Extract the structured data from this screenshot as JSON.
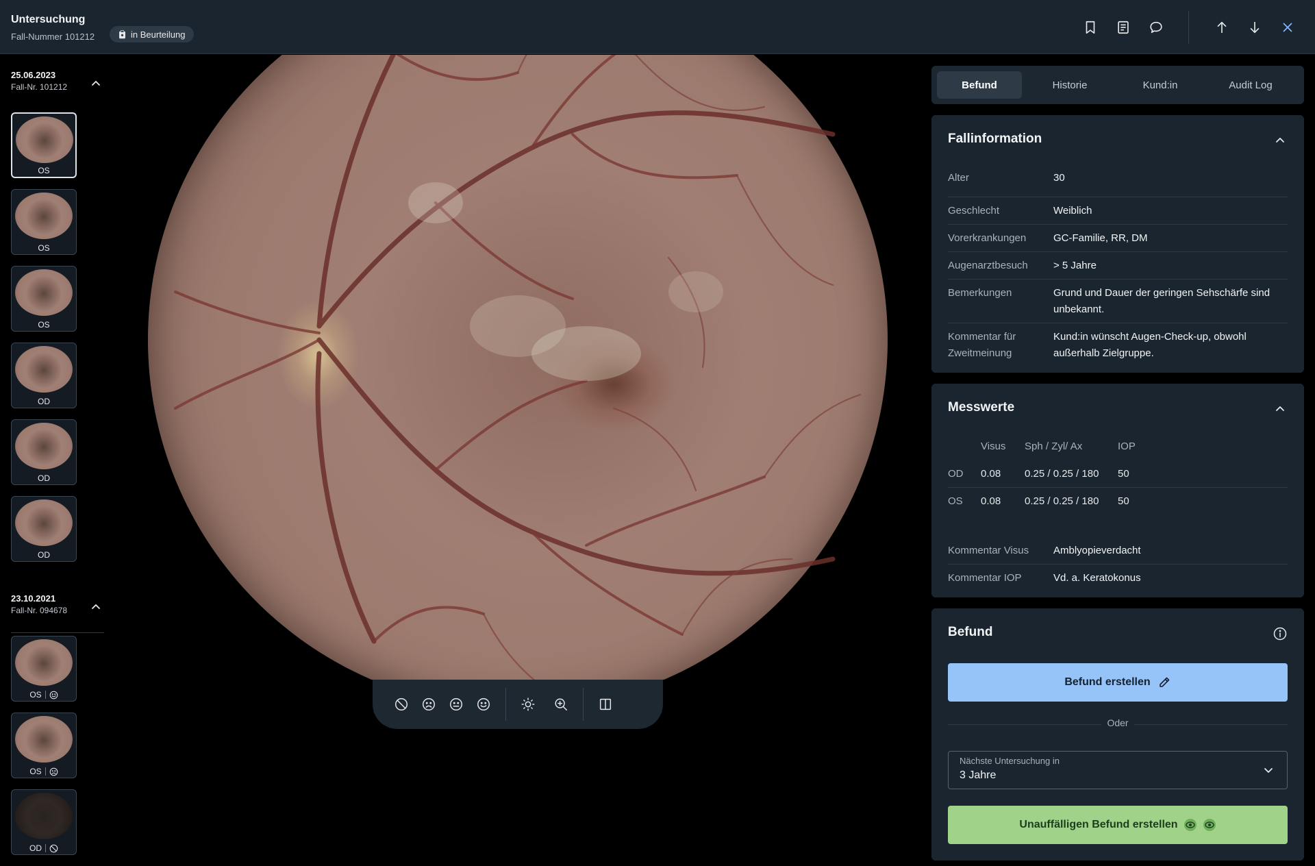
{
  "header": {
    "title": "Untersuchung",
    "case_number": "Fall-Nummer 101212",
    "status": "in Beurteilung"
  },
  "sidebar": {
    "groups": [
      {
        "date": "25.06.2023",
        "case": "Fall-Nr. 101212",
        "images": [
          {
            "eye": "OS",
            "rating": "",
            "selected": true
          },
          {
            "eye": "OS",
            "rating": ""
          },
          {
            "eye": "OS",
            "rating": ""
          },
          {
            "eye": "OD",
            "rating": ""
          },
          {
            "eye": "OD",
            "rating": ""
          },
          {
            "eye": "OD",
            "rating": ""
          }
        ]
      },
      {
        "date": "23.10.2021",
        "case": "Fall-Nr. 094678",
        "images": [
          {
            "eye": "OS",
            "rating": "smile-icon"
          },
          {
            "eye": "OS",
            "rating": "frown-icon"
          },
          {
            "eye": "OD",
            "rating": "ungradable-icon"
          }
        ]
      }
    ]
  },
  "tabs": [
    "Befund",
    "Historie",
    "Kund:in",
    "Audit Log"
  ],
  "active_tab": "Befund",
  "fallinformation": {
    "title": "Fallinformation",
    "rows": [
      {
        "key": "Alter",
        "value": "30"
      },
      {
        "key": "Geschlecht",
        "value": "Weiblich"
      },
      {
        "key": "Vorerkrankungen",
        "value": "GC-Familie, RR, DM"
      },
      {
        "key": "Augenarztbesuch",
        "value": "> 5 Jahre"
      },
      {
        "key": "Bemerkungen",
        "value": "Grund und Dauer der geringen Sehschärfe sind unbekannt."
      },
      {
        "key": "Kommentar für Zweitmeinung",
        "value": "Kund:in wünscht Augen-Check-up, obwohl außerhalb Zielgruppe."
      }
    ]
  },
  "messwerte": {
    "title": "Messwerte",
    "columns": [
      "Visus",
      "Sph / Zyl/ Ax",
      "IOP"
    ],
    "rows": [
      {
        "eye": "OD",
        "visus": "0.08",
        "refraction": "0.25 / 0.25 / 180",
        "iop": "50"
      },
      {
        "eye": "OS",
        "visus": "0.08",
        "refraction": "0.25 / 0.25 / 180",
        "iop": "50"
      }
    ],
    "comments": [
      {
        "key": "Kommentar Visus",
        "value": "Amblyopieverdacht"
      },
      {
        "key": "Kommentar IOP",
        "value": "Vd. a. Keratokonus"
      }
    ]
  },
  "befund": {
    "title": "Befund",
    "create_label": "Befund erstellen",
    "or_label": "Oder",
    "next_exam_label": "Nächste Untersuchung in",
    "next_exam_value": "3 Jahre",
    "normal_label": "Unauffälligen Befund erstellen"
  },
  "colors": {
    "topbar_bg": "#1a2530",
    "card_bg": "#1a2530",
    "primary_button": "#96c3f8",
    "success_button": "#a0d389",
    "close_accent": "#7fb3ff"
  }
}
